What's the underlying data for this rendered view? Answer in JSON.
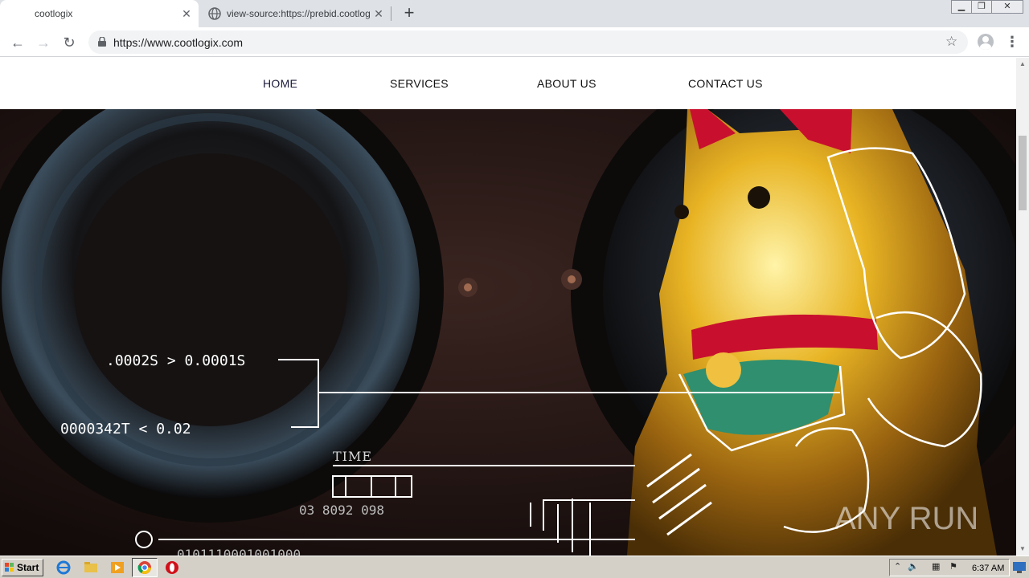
{
  "browser": {
    "tabs": [
      {
        "label": "cootlogix",
        "active": true
      },
      {
        "label": "view-source:https://prebid.cootlogix",
        "active": false
      }
    ],
    "new_tab_symbol": "+",
    "close_symbol": "✕",
    "url": "https://www.cootlogix.com",
    "window_controls": [
      "minimize",
      "restore",
      "close"
    ]
  },
  "site": {
    "nav": [
      {
        "label": "HOME"
      },
      {
        "label": "SERVICES"
      },
      {
        "label": "ABOUT US"
      },
      {
        "label": "CONTACT US"
      }
    ],
    "hero": {
      "readout_1": ".0002S > 0.0001S",
      "readout_2": "0000342T < 0.02",
      "time_label": "TIME",
      "time_value": "03 8092 098",
      "binary": "0101110001001000",
      "watermark": "ANY RUN"
    }
  },
  "taskbar": {
    "start_label": "Start",
    "clock": "6:37 AM"
  },
  "colors": {
    "tab_strip": "#dee1e6",
    "gold": "#d4a017",
    "collar_red": "#c8102e",
    "bib_green": "#2f8f6f",
    "nav_active": "#1a1a3a"
  }
}
